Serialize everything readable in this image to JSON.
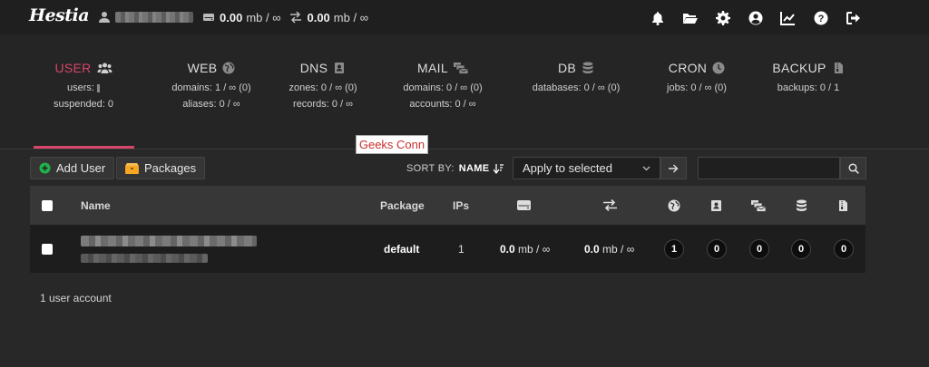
{
  "brand": {
    "logo": "Hestia"
  },
  "topbar": {
    "disk_value": "0.00",
    "disk_unit": "mb / ∞",
    "bandwidth_value": "0.00",
    "bandwidth_unit": "mb / ∞",
    "icons": [
      "bell-icon",
      "folder-open-icon",
      "gear-icon",
      "user-circle-icon",
      "chart-line-icon",
      "help-icon",
      "logout-icon"
    ]
  },
  "tabs": [
    {
      "title": "USER",
      "icon": "users-icon",
      "lines": [
        "users:",
        "suspended: 0"
      ],
      "active": true
    },
    {
      "title": "WEB",
      "icon": "globe-icon",
      "lines": [
        "domains: 1 / ∞ (0)",
        "aliases: 0 / ∞"
      ]
    },
    {
      "title": "DNS",
      "icon": "address-book-icon",
      "lines": [
        "zones: 0 / ∞ (0)",
        "records: 0 / ∞"
      ]
    },
    {
      "title": "MAIL",
      "icon": "mail-bulk-icon",
      "lines": [
        "domains: 0 / ∞ (0)",
        "accounts: 0 / ∞"
      ]
    },
    {
      "title": "DB",
      "icon": "database-icon",
      "lines": [
        "databases: 0 / ∞ (0)"
      ]
    },
    {
      "title": "CRON",
      "icon": "clock-icon",
      "lines": [
        "jobs: 0 / ∞ (0)"
      ]
    },
    {
      "title": "BACKUP",
      "icon": "file-archive-icon",
      "lines": [
        "backups: 0 / 1"
      ]
    }
  ],
  "tooltip": "Geeks Conn",
  "toolbar": {
    "add_user": "Add User",
    "packages": "Packages",
    "sort_label": "SORT BY:",
    "sort_value": "NAME",
    "bulk_action": "Apply to selected",
    "search_placeholder": ""
  },
  "table": {
    "headers": {
      "name": "Name",
      "package": "Package",
      "ips": "IPs"
    },
    "rows": [
      {
        "package": "default",
        "ips": "1",
        "disk_value": "0.0",
        "disk_unit": "mb / ∞",
        "bw_value": "0.0",
        "bw_unit": "mb / ∞",
        "web": "1",
        "dns": "0",
        "mail": "0",
        "db": "0",
        "backup": "0"
      }
    ]
  },
  "footer": "1 user account",
  "colors": {
    "accent": "#d6456a",
    "add_icon": "#22b14c",
    "packages_icon": "#f5a623"
  }
}
